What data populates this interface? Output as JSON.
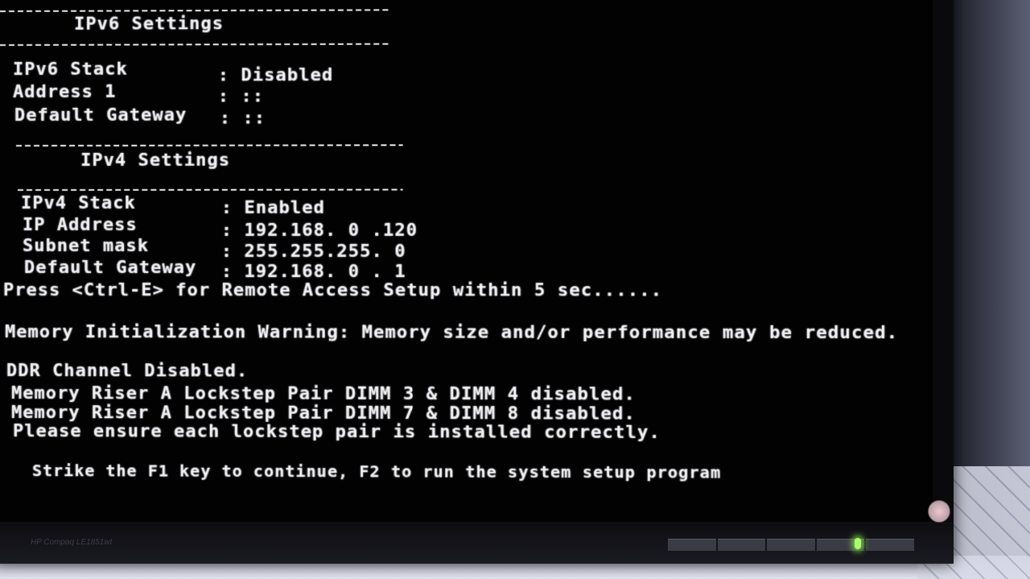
{
  "ipv6_header": "IPv6 Settings",
  "ipv6": [
    {
      "label": "IPv6 Stack",
      "value": ": Disabled"
    },
    {
      "label": "Address 1",
      "value": ": ::"
    },
    {
      "label": "Default Gateway",
      "value": ": ::"
    }
  ],
  "ipv4_header": "IPv4 Settings",
  "ipv4": [
    {
      "label": "IPv4 Stack",
      "value": ": Enabled"
    },
    {
      "label": "IP Address",
      "value": ": 192.168. 0 .120"
    },
    {
      "label": "Subnet mask",
      "value": ": 255.255.255. 0"
    },
    {
      "label": "Default Gateway",
      "value": ": 192.168. 0 . 1"
    }
  ],
  "messages": {
    "remote_access": "Press <Ctrl-E> for Remote Access Setup within 5 sec......",
    "memory_warning": "Memory Initialization Warning: Memory size and/or performance may be reduced.",
    "ddr_disabled": "DDR Channel Disabled.",
    "riser_pair_1": "Memory Riser A Lockstep Pair DIMM 3 & DIMM 4 disabled.",
    "riser_pair_2": "Memory Riser A Lockstep Pair DIMM 7 & DIMM 8 disabled.",
    "lockstep_note": "Please ensure each lockstep pair is installed correctly.",
    "prompt": "Strike the F1 key to continue, F2 to run the system setup program"
  },
  "monitor": {
    "brand_label": "HP Compaq LE1851wt",
    "power_led_color": "#a8ff6a"
  }
}
